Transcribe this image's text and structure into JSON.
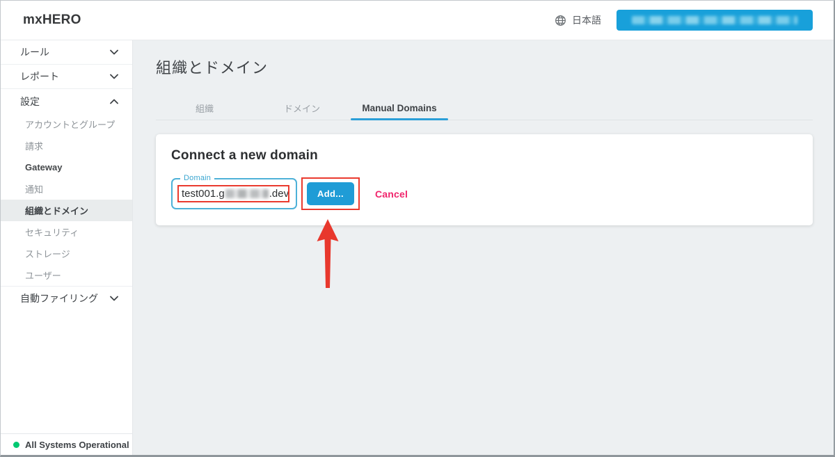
{
  "header": {
    "logo": "mxHERO",
    "language": "日本語",
    "account_button": {
      "redacted": true
    }
  },
  "sidebar": {
    "sections": [
      {
        "label": "ルール",
        "expanded": false
      },
      {
        "label": "レポート",
        "expanded": false
      },
      {
        "label": "設定",
        "expanded": true,
        "children": [
          {
            "label": "アカウントとグループ"
          },
          {
            "label": "請求"
          },
          {
            "label": "Gateway",
            "emphasis": true
          },
          {
            "label": "通知"
          },
          {
            "label": "組織とドメイン",
            "selected": true
          },
          {
            "label": "セキュリティ"
          },
          {
            "label": "ストレージ"
          },
          {
            "label": "ユーザー"
          }
        ]
      },
      {
        "label": "自動ファイリング",
        "expanded": false
      }
    ],
    "status": {
      "text": "All Systems Operational"
    }
  },
  "main": {
    "page_title": "組織とドメイン",
    "tabs": [
      {
        "label": "組織",
        "active": false
      },
      {
        "label": "ドメイン",
        "active": false
      },
      {
        "label": "Manual Domains",
        "active": true
      }
    ],
    "card": {
      "title": "Connect a new domain",
      "domain_field": {
        "label": "Domain",
        "value_prefix": "test001.g",
        "value_suffix": ".dev",
        "middle_redacted": true
      },
      "add_button": "Add...",
      "cancel_link": "Cancel"
    }
  },
  "colors": {
    "accent_blue": "#1f9cd6",
    "tab_underline_blue": "#2b9fd8",
    "input_cyan": "#4db1d8",
    "annotation_red": "#ea3a2e",
    "arrow_red": "#e8382d",
    "cancel_pink": "#f0256c",
    "status_green": "#00c972",
    "content_background": "#edf0f2"
  }
}
